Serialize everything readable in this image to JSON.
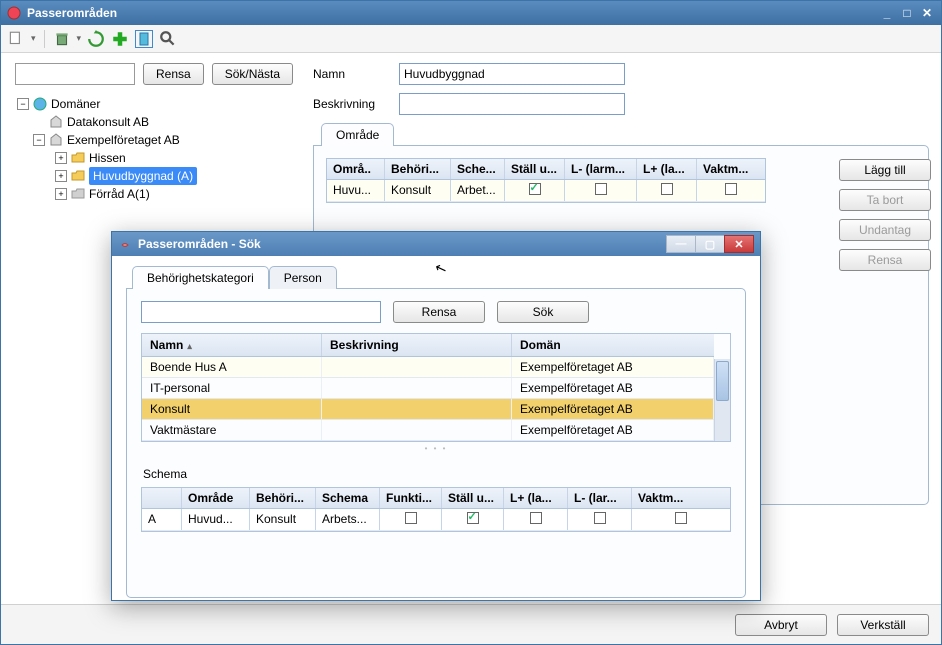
{
  "window": {
    "title": "Passerområden"
  },
  "toolbar": {},
  "left": {
    "clear_btn": "Rensa",
    "search_btn": "Sök/Nästa",
    "tree": {
      "root": "Domäner",
      "n1": "Datakonsult AB",
      "n2": "Exempelföretaget AB",
      "n2a": "Hissen",
      "n2b": "Huvudbyggnad (A)",
      "n2c": "Förråd A(1)"
    }
  },
  "form": {
    "name_label": "Namn",
    "name_value": "Huvudbyggnad",
    "desc_label": "Beskrivning",
    "desc_value": ""
  },
  "tab": {
    "omrade": "Område"
  },
  "grid1": {
    "h": {
      "omrade": "Områ..",
      "behorig": "Behöri...",
      "schema": "Sche...",
      "stall": "Ställ u...",
      "lminus": "L- (larm...",
      "lplus": "L+ (la...",
      "vakt": "Vaktm..."
    },
    "r1": {
      "omrade": "Huvu...",
      "behorig": "Konsult",
      "schema": "Arbet..."
    }
  },
  "side": {
    "add": "Lägg till",
    "del": "Ta bort",
    "undantag": "Undantag",
    "rensa": "Rensa"
  },
  "footer": {
    "avbryt": "Avbryt",
    "verkstall": "Verkställ"
  },
  "dialog": {
    "title": "Passerområden - Sök",
    "tab_kat": "Behörighetskategori",
    "tab_person": "Person",
    "rensa": "Rensa",
    "sok": "Sök",
    "grid_h": {
      "namn": "Namn",
      "beskriv": "Beskrivning",
      "doman": "Domän"
    },
    "rows": {
      "r1": {
        "namn": "Boende Hus A",
        "beskriv": "",
        "doman": "Exempelföretaget AB"
      },
      "r2": {
        "namn": "IT-personal",
        "beskriv": "",
        "doman": "Exempelföretaget AB"
      },
      "r3": {
        "namn": "Konsult",
        "beskriv": "",
        "doman": "Exempelföretaget AB"
      },
      "r4": {
        "namn": "Vaktmästare",
        "beskriv": "",
        "doman": "Exempelföretaget AB"
      }
    },
    "schema_label": "Schema",
    "schema_h": {
      "blank": "",
      "omrade": "Område",
      "behorig": "Behöri...",
      "schema": "Schema",
      "funkt": "Funkti...",
      "stall": "Ställ u...",
      "lplus": "L+ (la...",
      "lminus": "L- (lar...",
      "vakt": "Vaktm..."
    },
    "schema_r1": {
      "name": "A",
      "omrade": "Huvud...",
      "behorig": "Konsult",
      "schema": "Arbets..."
    }
  }
}
